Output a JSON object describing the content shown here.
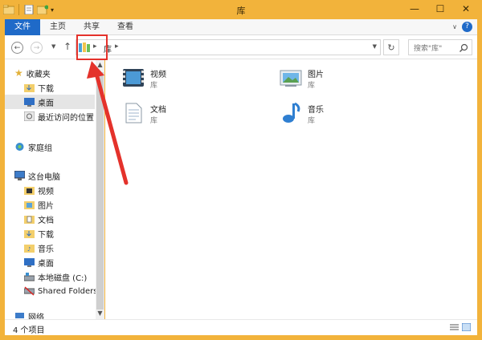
{
  "window": {
    "title": "库"
  },
  "ribbon": {
    "tabs": [
      "文件",
      "主页",
      "共享",
      "查看"
    ]
  },
  "address": {
    "crumb": "库"
  },
  "search": {
    "placeholder": "搜索\"库\""
  },
  "sidebar": {
    "favorites": {
      "label": "收藏夹",
      "items": [
        "下载",
        "桌面",
        "最近访问的位置"
      ]
    },
    "homegroup": "家庭组",
    "thispc": {
      "label": "这台电脑",
      "items": [
        "视频",
        "图片",
        "文档",
        "下载",
        "音乐",
        "桌面",
        "本地磁盘 (C:)",
        "Shared Folders"
      ]
    },
    "cutoff": "网络"
  },
  "libraries": [
    {
      "name": "视频",
      "type": "库",
      "icon": "video-library-icon"
    },
    {
      "name": "图片",
      "type": "库",
      "icon": "pictures-library-icon"
    },
    {
      "name": "文档",
      "type": "库",
      "icon": "documents-library-icon"
    },
    {
      "name": "音乐",
      "type": "库",
      "icon": "music-library-icon"
    }
  ],
  "status": {
    "count": "4 个项目"
  },
  "colors": {
    "titlebar": "#f2b33b",
    "accent": "#1f6ac8",
    "annotation": "#e4322b"
  }
}
